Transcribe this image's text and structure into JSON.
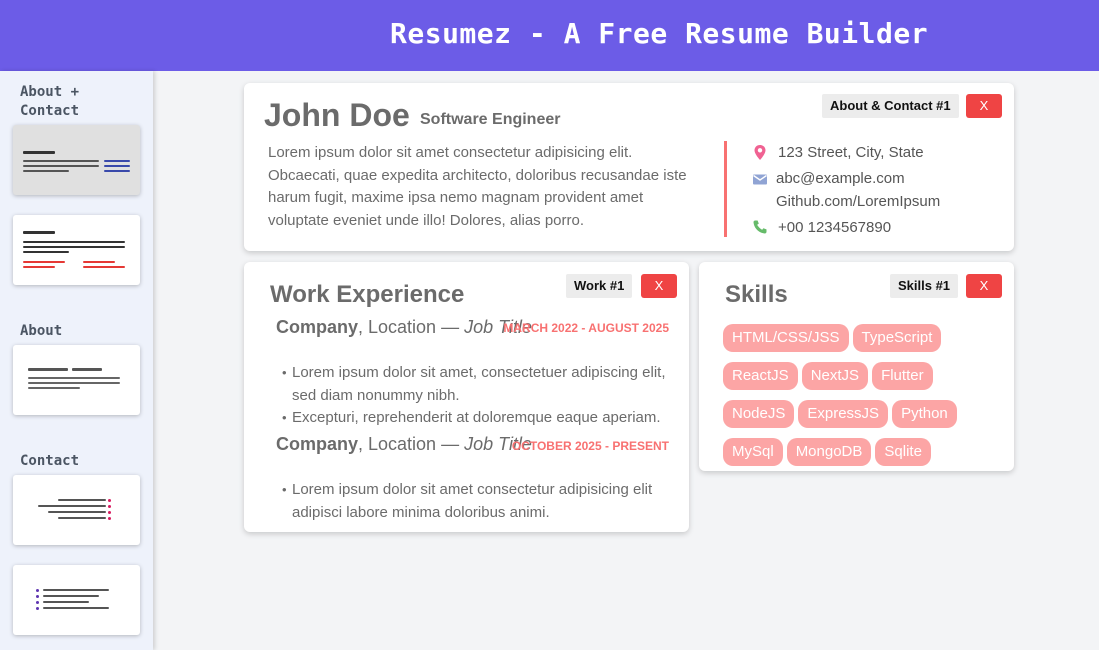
{
  "app": {
    "title": "Resumez - A Free Resume Builder"
  },
  "sidebar": {
    "sections": [
      {
        "label": "About + Contact"
      },
      {
        "label": "About"
      },
      {
        "label": "Contact"
      }
    ]
  },
  "about": {
    "tag": "About & Contact #1",
    "remove_label": "X",
    "name": "John Doe",
    "role": "Software Engineer",
    "summary": "Lorem ipsum dolor sit amet consectetur adipisicing elit. Obcaecati, quae expedita architecto, doloribus recusandae iste harum fugit, maxime ipsa nemo magnam provident amet voluptate eveniet unde illo! Dolores, alias porro.",
    "contact": {
      "address": "123 Street, City, State",
      "email": "abc@example.com",
      "github": "Github.com/LoremIpsum",
      "phone": "+00 1234567890"
    }
  },
  "work": {
    "tag": "Work #1",
    "remove_label": "X",
    "title": "Work Experience",
    "jobs": [
      {
        "company": "Company",
        "location": ", Location — ",
        "job_title": "Job Title",
        "dates": "MARCH 2022 - AUGUST 2025",
        "bullets": [
          "Lorem ipsum dolor sit amet, consectetuer adipiscing elit, sed diam nonummy nibh.",
          "Excepturi, reprehenderit at doloremque eaque aperiam."
        ]
      },
      {
        "company": "Company",
        "location": ", Location — ",
        "job_title": "Job Title",
        "dates": "OCTOBER 2025 - PRESENT",
        "bullets": [
          "Lorem ipsum dolor sit amet consectetur adipisicing elit adipisci labore minima doloribus animi."
        ]
      }
    ]
  },
  "skills": {
    "tag": "Skills #1",
    "remove_label": "X",
    "title": "Skills",
    "items": [
      "HTML/CSS/JSS",
      "TypeScript",
      "ReactJS",
      "NextJS",
      "Flutter",
      "NodeJS",
      "ExpressJS",
      "Python",
      "MySql",
      "MongoDB",
      "Sqlite"
    ]
  },
  "colors": {
    "header_bg": "#6c5ce7",
    "accent_red": "#ef4444",
    "chip_bg": "#fca5a5",
    "divider": "#f87171"
  },
  "icons": {
    "address": "location-pin-icon",
    "email": "mail-icon",
    "phone": "phone-icon"
  }
}
